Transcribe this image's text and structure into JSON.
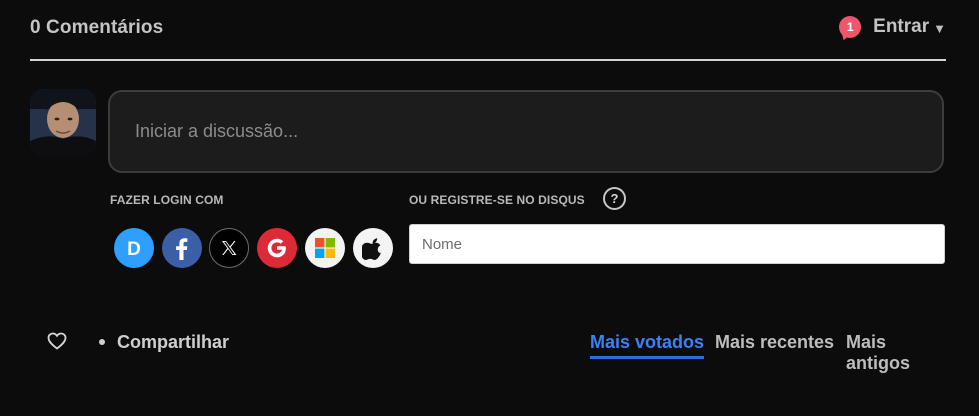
{
  "header": {
    "comment_count_label": "0 Comentários",
    "notification_count": "1",
    "login_label": "Entrar"
  },
  "composer": {
    "placeholder": "Iniciar a discussão..."
  },
  "login": {
    "section_label": "FAZER LOGIN COM",
    "providers": [
      "disqus-icon",
      "facebook-icon",
      "x-icon",
      "google-icon",
      "microsoft-icon",
      "apple-icon"
    ]
  },
  "register": {
    "section_label": "OU REGISTRE-SE NO DISQUS",
    "help": "?",
    "name_placeholder": "Nome"
  },
  "footer": {
    "share_label": "Compartilhar",
    "sort_options": [
      "Mais votados",
      "Mais recentes",
      "Mais antigos"
    ],
    "active_sort": "Mais votados"
  },
  "colors": {
    "background": "#0c0c0d",
    "accent": "#3b82f6",
    "notification": "#f0566b"
  }
}
